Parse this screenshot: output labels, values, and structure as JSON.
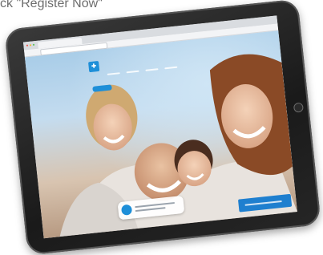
{
  "caption": "ck \"Register Now\"",
  "browser": {
    "window_controls": [
      "close",
      "minimize",
      "maximize"
    ]
  },
  "logo": {
    "icon": "cross-mark-icon",
    "mark_glyph": "✚",
    "brand_color": "#1e8fd8"
  },
  "colors": {
    "accent": "#1e8fd8",
    "banner": "#1e7fcf"
  }
}
